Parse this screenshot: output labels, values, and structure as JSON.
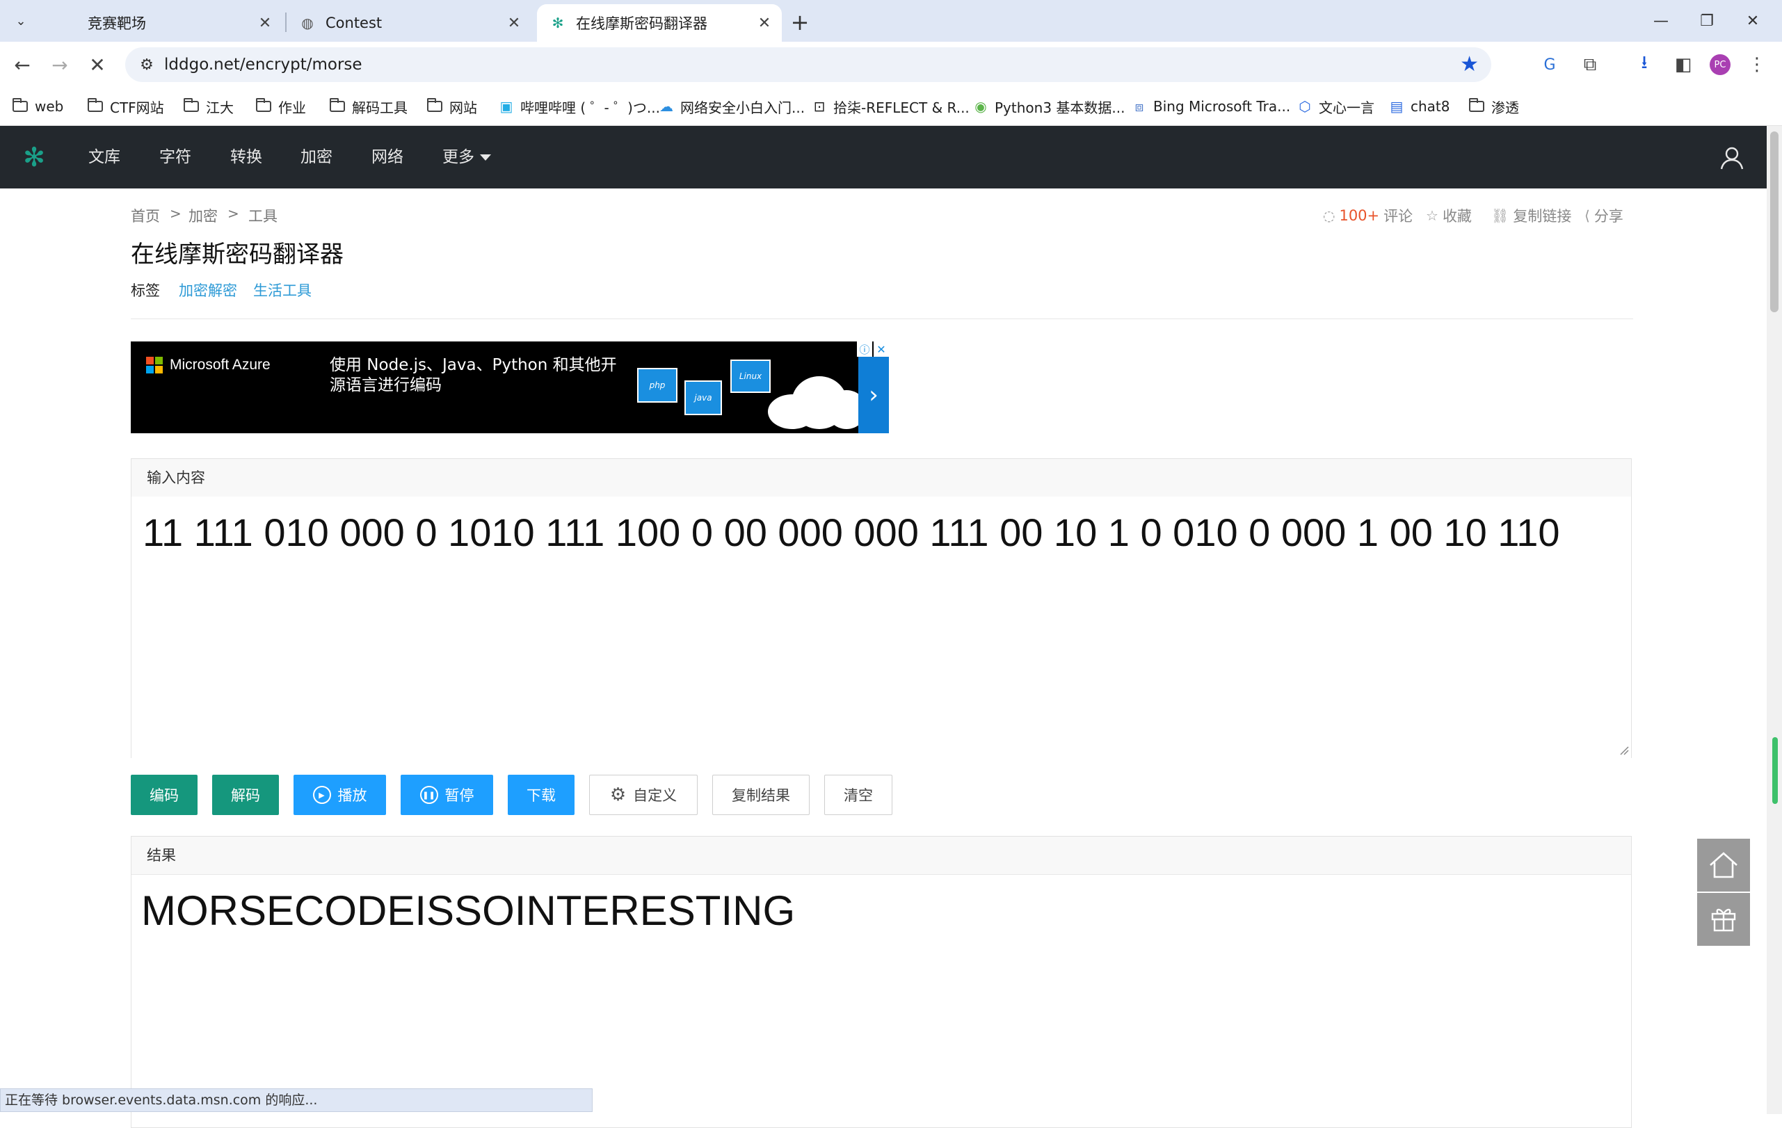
{
  "browser": {
    "tabs": [
      {
        "title": "竞赛靶场",
        "active": false
      },
      {
        "title": "Contest",
        "active": false
      },
      {
        "title": "在线摩斯密码翻译器",
        "active": true
      }
    ],
    "url": "lddgo.net/encrypt/morse",
    "profile_initials": "PC",
    "bookmarks": [
      {
        "label": "web",
        "icon": "folder-icon"
      },
      {
        "label": "CTF网站",
        "icon": "folder-icon"
      },
      {
        "label": "江大",
        "icon": "folder-icon"
      },
      {
        "label": "作业",
        "icon": "folder-icon"
      },
      {
        "label": "解码工具",
        "icon": "folder-icon"
      },
      {
        "label": "网站",
        "icon": "folder-icon"
      },
      {
        "label": "哔哩哔哩 ( ゜- ゜)つ...",
        "icon": "bilibili-icon"
      },
      {
        "label": "网络安全小白入门...",
        "icon": "cloud-icon"
      },
      {
        "label": "拾柒-REFLECT & R...",
        "icon": "blog-icon"
      },
      {
        "label": "Python3 基本数据...",
        "icon": "runoob-icon"
      },
      {
        "label": "Bing Microsoft Tra...",
        "icon": "translate-icon"
      },
      {
        "label": "文心一言",
        "icon": "ernie-icon"
      },
      {
        "label": "chat8",
        "icon": "chat-icon"
      },
      {
        "label": "渗透",
        "icon": "folder-icon"
      }
    ],
    "status_text": "正在等待 browser.events.data.msn.com 的响应..."
  },
  "site": {
    "nav": [
      "文库",
      "字符",
      "转换",
      "加密",
      "网络",
      "更多"
    ],
    "accent": "#15977d"
  },
  "page": {
    "breadcrumb": [
      "首页",
      "加密",
      "工具"
    ],
    "breadcrumb_sep": ">",
    "title": "在线摩斯密码翻译器",
    "tags_label": "标签",
    "tags": [
      "加密解密",
      "生活工具"
    ],
    "meta": {
      "comments_count": "100+",
      "comments_label": "评论",
      "favorite": "收藏",
      "copy_link": "复制链接",
      "share": "分享"
    }
  },
  "ad": {
    "brand": "Microsoft Azure",
    "text": "使用 Node.js、Java、Python 和其他开源语言进行编码",
    "box_php": "php",
    "box_java": "java",
    "box_linux": "Linux"
  },
  "input": {
    "label": "输入内容",
    "value": "11 111 010 000 0 1010 111 100 0 00 000 000 111 00 10 1 0 010 0 000 1 00 10 110"
  },
  "buttons": {
    "encode": "编码",
    "decode": "解码",
    "play": "播放",
    "pause": "暂停",
    "download": "下载",
    "custom": "自定义",
    "copy_result": "复制结果",
    "clear": "清空"
  },
  "result": {
    "label": "结果",
    "value": "MORSECODEISSOINTERESTING"
  }
}
